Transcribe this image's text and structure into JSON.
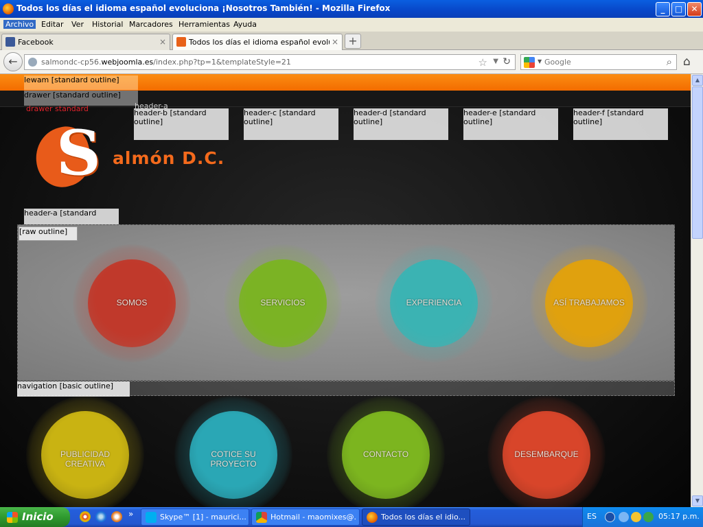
{
  "window": {
    "title": "Todos los días el idioma español evoluciona ¡Nosotros También! - Mozilla Firefox",
    "minimize": "_",
    "maximize": "□",
    "close": "✕"
  },
  "menu": [
    "Archivo",
    "Editar",
    "Ver",
    "Historial",
    "Marcadores",
    "Herramientas",
    "Ayuda"
  ],
  "tabs": [
    {
      "label": "Facebook",
      "close": "×"
    },
    {
      "label": "Todos los días el idioma español evolucio...",
      "close": "×"
    }
  ],
  "newtab": "+",
  "nav": {
    "back": "←",
    "url_prefix": "salmondc-cp56.",
    "url_domain": "webjoomla.es",
    "url_path": "/index.php?tp=1&templateStyle=21",
    "search_placeholder": "Google"
  },
  "page": {
    "modules": {
      "toolbar": {
        "name": "lewam",
        "style": "[standard outline]"
      },
      "drawer": {
        "name": "drawer",
        "style": "[standard outline]"
      },
      "drawer_sub": {
        "name": "drawer",
        "style": "standard"
      },
      "header_label": "header-a",
      "headers": [
        {
          "name": "header-b",
          "style": "[standard",
          "style2": "outline]"
        },
        {
          "name": "header-c",
          "style": "[standard",
          "style2": "outline]"
        },
        {
          "name": "header-d",
          "style": "[standard",
          "style2": "outline]"
        },
        {
          "name": "header-e",
          "style": "[standard",
          "style2": "outline]"
        },
        {
          "name": "header-f",
          "style": "[standard",
          "style2": "outline]"
        }
      ],
      "header_a": {
        "name": "header-a",
        "style": "[standard",
        "style2": "[raw outline]"
      },
      "navigation": {
        "name": "navigation",
        "style": "[basic outline]"
      }
    },
    "logo": {
      "s": "S",
      "brand": "almón D.C."
    },
    "circles_top": [
      {
        "label": "SOMOS",
        "color": "#c0392b"
      },
      {
        "label": "SERVICIOS",
        "color": "#7bb324"
      },
      {
        "label": "EXPERIENCIA",
        "color": "#3bb3b3"
      },
      {
        "label": "ASÍ TRABAJAMOS",
        "color": "#e0a10e"
      }
    ],
    "circles_bottom": [
      {
        "label": "PUBLICIDAD CREATIVA",
        "color": "#c9b312"
      },
      {
        "label": "COTICE SU PROYECTO",
        "color": "#2aa7b5"
      },
      {
        "label": "CONTACTO",
        "color": "#7cb51f"
      },
      {
        "label": "DESEMBARQUE",
        "color": "#d8452a"
      }
    ]
  },
  "taskbar": {
    "start": "Inicio",
    "more": "»",
    "tasks": [
      {
        "label": "Skype™ [1] - maurici...",
        "color": "#f2a300"
      },
      {
        "label": "Hotmail - maomixes@...",
        "color": "#3c9e3c"
      },
      {
        "label": "Todos los días el idio...",
        "color": "#e46a12"
      }
    ],
    "lang": "ES",
    "clock": "05:17 p.m."
  }
}
